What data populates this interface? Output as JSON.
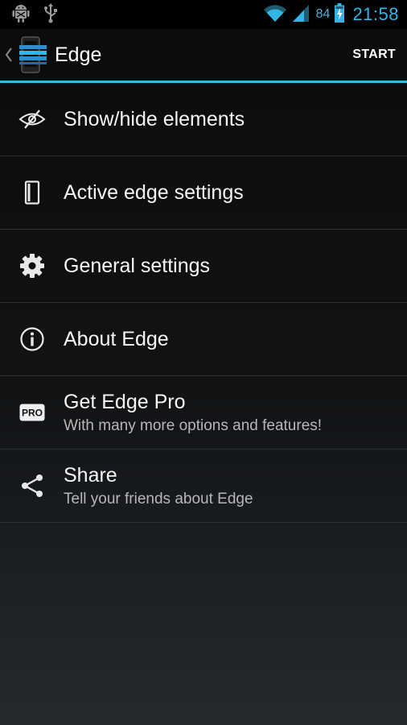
{
  "status_bar": {
    "battery_level": "84",
    "time": "21:58",
    "icons": [
      "android-debug-icon",
      "usb-icon",
      "wifi-icon",
      "signal-icon",
      "battery-charging-icon"
    ],
    "accent_color": "#33b5e5"
  },
  "action_bar": {
    "title": "Edge",
    "action_label": "START",
    "icons": [
      "back-caret-icon",
      "edge-app-logo-icon"
    ]
  },
  "menu": {
    "items": [
      {
        "title": "Show/hide elements",
        "subtitle": "",
        "icon": "eye-slash-icon"
      },
      {
        "title": "Active edge settings",
        "subtitle": "",
        "icon": "phone-edge-icon"
      },
      {
        "title": "General settings",
        "subtitle": "",
        "icon": "gear-icon"
      },
      {
        "title": "About Edge",
        "subtitle": "",
        "icon": "info-icon"
      },
      {
        "title": "Get Edge Pro",
        "subtitle": "With many more options and features!",
        "icon": "pro-badge-icon"
      },
      {
        "title": "Share",
        "subtitle": "Tell your friends about Edge",
        "icon": "share-icon"
      }
    ]
  }
}
